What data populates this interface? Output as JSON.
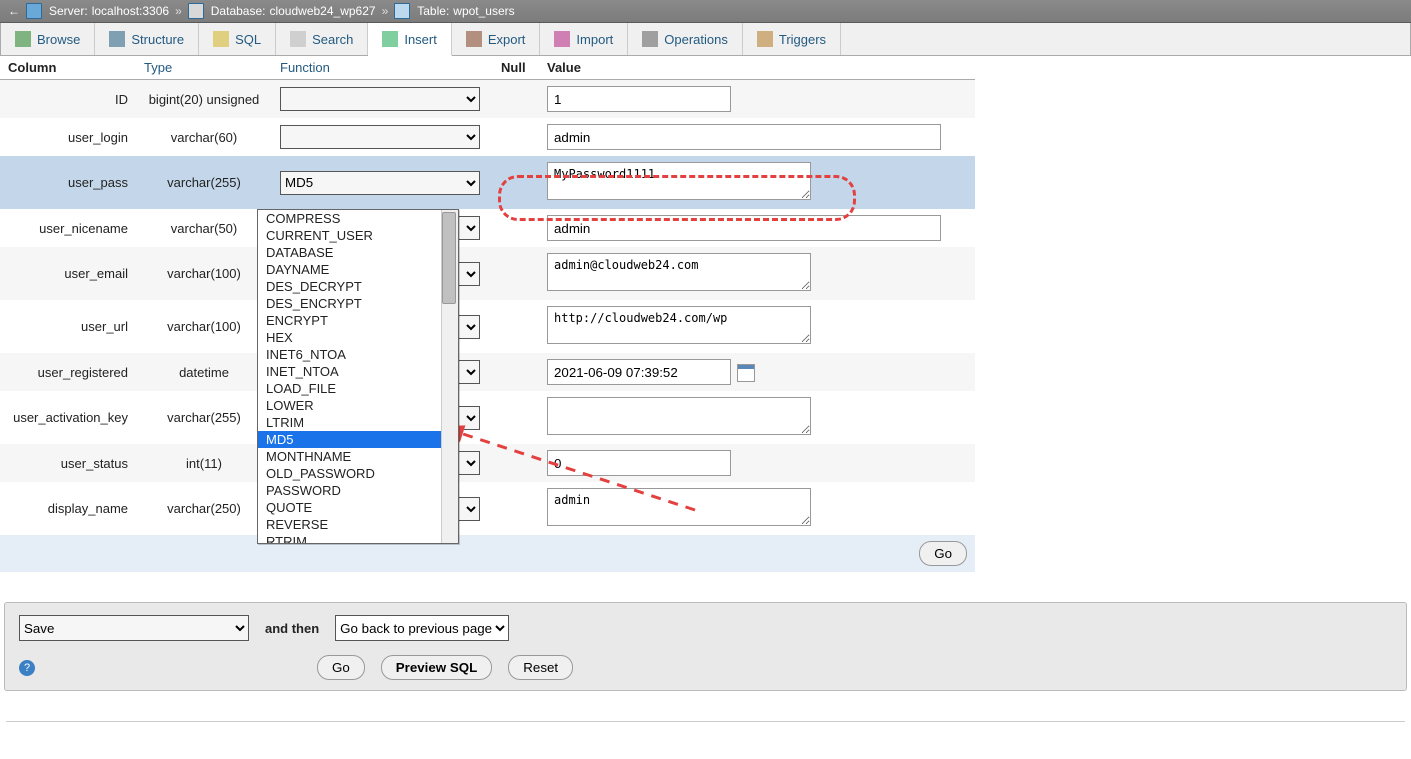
{
  "breadcrumb": {
    "server_label": "Server:",
    "server": "localhost:3306",
    "db_label": "Database:",
    "db": "cloudweb24_wp627",
    "table_label": "Table:",
    "table": "wpot_users"
  },
  "tabs": {
    "browse": "Browse",
    "structure": "Structure",
    "sql": "SQL",
    "search": "Search",
    "insert": "Insert",
    "export": "Export",
    "import": "Import",
    "operations": "Operations",
    "triggers": "Triggers"
  },
  "headers": {
    "column": "Column",
    "type": "Type",
    "function": "Function",
    "null": "Null",
    "value": "Value"
  },
  "rows": [
    {
      "col": "ID",
      "type": "bigint(20) unsigned",
      "fn": "",
      "val": "1",
      "kind": "short"
    },
    {
      "col": "user_login",
      "type": "varchar(60)",
      "fn": "",
      "val": "admin",
      "kind": "norm"
    },
    {
      "col": "user_pass",
      "type": "varchar(255)",
      "fn": "MD5",
      "val": "MyPassword1111",
      "kind": "ta"
    },
    {
      "col": "user_nicename",
      "type": "varchar(50)",
      "fn": "",
      "val": "admin",
      "kind": "norm"
    },
    {
      "col": "user_email",
      "type": "varchar(100)",
      "fn": "",
      "val": "admin@cloudweb24.com",
      "kind": "ta"
    },
    {
      "col": "user_url",
      "type": "varchar(100)",
      "fn": "",
      "val": "http://cloudweb24.com/wp",
      "kind": "ta"
    },
    {
      "col": "user_registered",
      "type": "datetime",
      "fn": "",
      "val": "2021-06-09 07:39:52",
      "kind": "date"
    },
    {
      "col": "user_activation_key",
      "type": "varchar(255)",
      "fn": "",
      "val": "",
      "kind": "ta"
    },
    {
      "col": "user_status",
      "type": "int(11)",
      "fn": "",
      "val": "0",
      "kind": "short"
    },
    {
      "col": "display_name",
      "type": "varchar(250)",
      "fn": "",
      "val": "admin",
      "kind": "ta"
    }
  ],
  "dropdown": {
    "items": [
      "COMPRESS",
      "CURRENT_USER",
      "DATABASE",
      "DAYNAME",
      "DES_DECRYPT",
      "DES_ENCRYPT",
      "ENCRYPT",
      "HEX",
      "INET6_NTOA",
      "INET_NTOA",
      "LOAD_FILE",
      "LOWER",
      "LTRIM",
      "MD5",
      "MONTHNAME",
      "OLD_PASSWORD",
      "PASSWORD",
      "QUOTE",
      "REVERSE",
      "RTRIM"
    ],
    "selected": "MD5"
  },
  "buttons": {
    "go": "Go",
    "preview": "Preview SQL",
    "reset": "Reset"
  },
  "actionbar": {
    "save": "Save",
    "and_then": "and then",
    "then_opt": "Go back to previous page"
  }
}
